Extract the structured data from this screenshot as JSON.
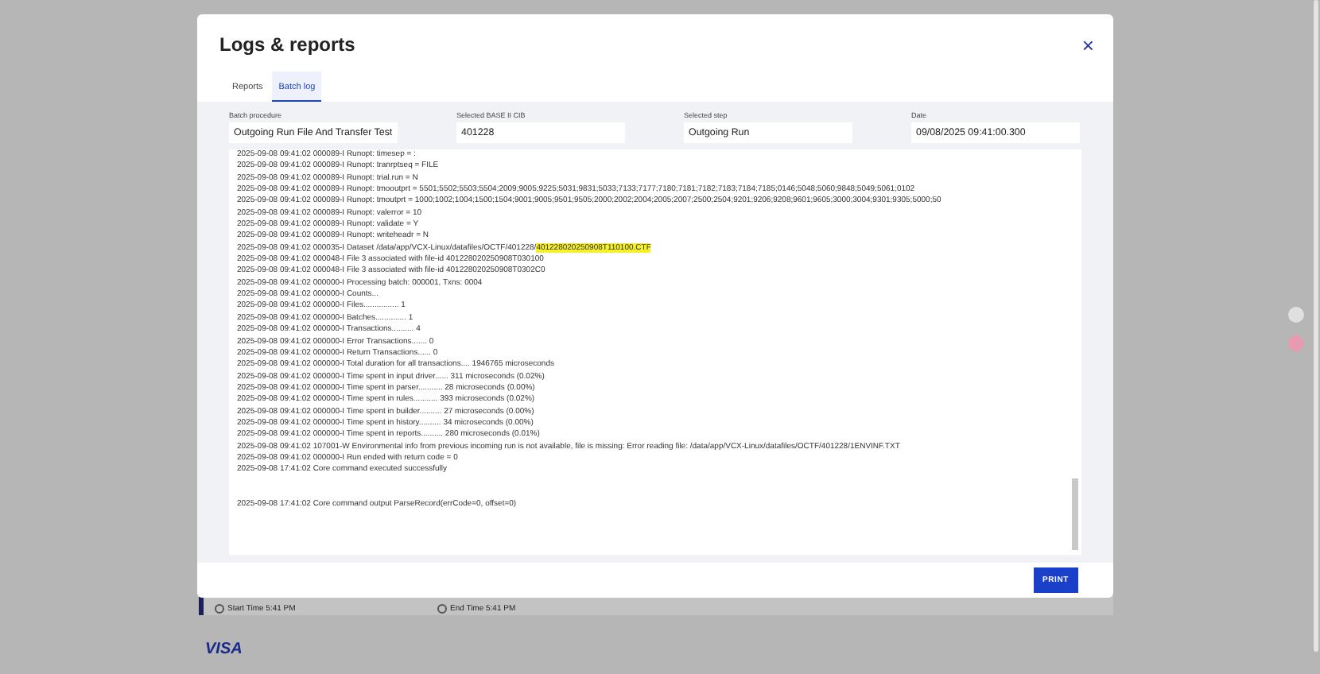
{
  "dialog": {
    "title": "Logs & reports",
    "close": "×",
    "tabs": [
      {
        "label": "Reports",
        "selected": false
      },
      {
        "label": "Batch log",
        "selected": true
      }
    ],
    "fields": [
      {
        "label": "Batch procedure",
        "value": "Outgoing Run File And Transfer Test"
      },
      {
        "label": "Selected BASE II CIB",
        "value": "401228"
      },
      {
        "label": "Selected step",
        "value": "Outgoing Run"
      },
      {
        "label": "Date",
        "value": "09/08/2025 09:41:00.300"
      }
    ],
    "log": [
      {
        "text": "2025-09-08 09:41:02 000089-I Runopt: timesep = :"
      },
      {
        "text": "2025-09-08 09:41:02 000089-I Runopt: tranrptseq = FILE"
      },
      {
        "text": "2025-09-08 09:41:02 000089-I Runopt: trial.run = N"
      },
      {
        "text": "2025-09-08 09:41:02 000089-I Runopt: tmooutprt = 5501;5502;5503;5504;2009;9005;9225;5031;9831;5033;7133;7177;7180;7181;7182;7183;7184;7185;0146;5048;5060;9848;5049;5061;0102"
      },
      {
        "text": "2025-09-08 09:41:02 000089-I Runopt: tmoutprt = 1000;1002;1004;1500;1504;9001;9005;9501;9505;2000;2002;2004;2005;2007;2500;2504;9201;9206;9208;9601;9605;3000;3004;9301;9305;5000;50"
      },
      {
        "text": "2025-09-08 09:41:02 000089-I Runopt: valerror = 10"
      },
      {
        "text": "2025-09-08 09:41:02 000089-I Runopt: validate = Y"
      },
      {
        "text": "2025-09-08 09:41:02 000089-I Runopt: writeheadr = N"
      },
      {
        "text": "2025-09-08 09:41:02 000035-I Dataset /data/app/VCX-Linux/datafiles/OCTF/401228/",
        "highlight": "401228020250908T110100.CTF"
      },
      {
        "text": "2025-09-08 09:41:02 000048-I File 3 associated with file-id 401228020250908T030100"
      },
      {
        "text": "2025-09-08 09:41:02 000048-I File 3 associated with file-id 401228020250908T0302C0"
      },
      {
        "text": "2025-09-08 09:41:02 000000-I Processing batch: 000001, Txns: 0004"
      },
      {
        "text": "2025-09-08 09:41:02 000000-I Counts..."
      },
      {
        "text": "2025-09-08 09:41:02 000000-I Files................ 1"
      },
      {
        "text": "2025-09-08 09:41:02 000000-I Batches.............. 1"
      },
      {
        "text": "2025-09-08 09:41:02 000000-I Transactions.......... 4"
      },
      {
        "text": "2025-09-08 09:41:02 000000-I Error Transactions....... 0"
      },
      {
        "text": "2025-09-08 09:41:02 000000-I Return Transactions...... 0"
      },
      {
        "text": "2025-09-08 09:41:02 000000-I Total duration for all transactions.... 1946765 microseconds"
      },
      {
        "text": "2025-09-08 09:41:02 000000-I Time spent in input driver...... 311 microseconds (0.02%)"
      },
      {
        "text": "2025-09-08 09:41:02 000000-I Time spent in parser........... 28 microseconds (0.00%)"
      },
      {
        "text": "2025-09-08 09:41:02 000000-I Time spent in rules........... 393 microseconds (0.02%)"
      },
      {
        "text": "2025-09-08 09:41:02 000000-I Time spent in builder.......... 27 microseconds (0.00%)"
      },
      {
        "text": "2025-09-08 09:41:02 000000-I Time spent in history.......... 34 microseconds (0.00%)"
      },
      {
        "text": "2025-09-08 09:41:02 000000-I Time spent in reports.......... 280 microseconds (0.01%)"
      },
      {
        "text": "2025-09-08 09:41:02 107001-W Environmental info from previous incoming run is not available, file is missing: Error reading file: /data/app/VCX-Linux/datafiles/OCTF/401228/1ENVINF.TXT"
      },
      {
        "text": "2025-09-08 09:41:02 000000-I Run ended with return code = 0"
      },
      {
        "text": "2025-09-08 17:41:02 Core command executed successfully",
        "gap_after": true
      },
      {
        "text": "2025-09-08 17:41:02 Core command output ParseRecord(errCode=0, offset=0)"
      }
    ],
    "print_button": "PRINT"
  },
  "background": {
    "start_time": "Start Time 5:41 PM",
    "end_time": "End Time 5:41 PM",
    "card_brand": "VISA"
  }
}
